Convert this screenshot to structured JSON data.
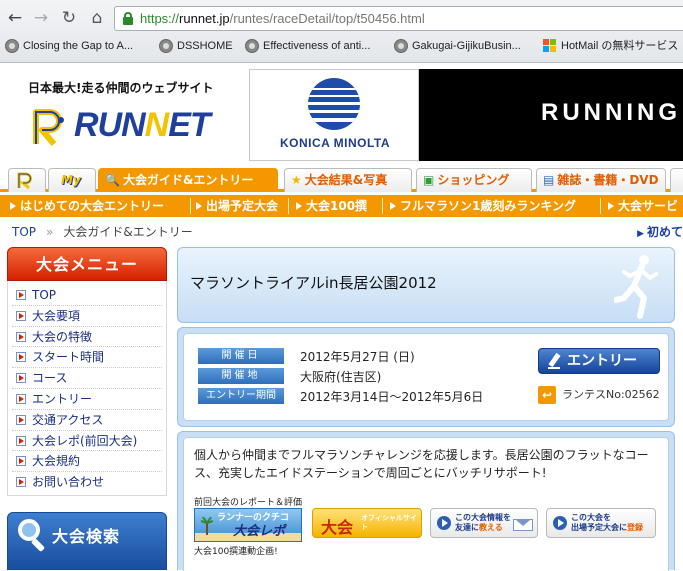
{
  "browser": {
    "url_scheme": "https://",
    "url_host": "runnet.jp",
    "url_path": "/runtes/raceDetail/top/t50456.html",
    "bookmarks": [
      {
        "label": "Closing the Gap to A...",
        "icon": "globe-icon"
      },
      {
        "label": "DSSHOME",
        "icon": "globe-icon"
      },
      {
        "label": "Effectiveness of anti...",
        "icon": "globe-icon"
      },
      {
        "label": "Gakugai-GijikuBusin...",
        "icon": "globe-icon"
      },
      {
        "label": "HotMail の無料サービス",
        "icon": "windows-icon"
      }
    ]
  },
  "site": {
    "tagline": "日本最大!走る仲間のウェブサイト",
    "logo_prefix": "RUN",
    "logo_highlight": "N",
    "logo_suffix": "ET",
    "ad_sponsor": "KONICA MINOLTA",
    "ad_banner": "RUNNING"
  },
  "tabs": [
    {
      "label": "",
      "icon": "runnet-home-icon"
    },
    {
      "label": "My",
      "icon": ""
    },
    {
      "label": "大会ガイド&エントリー",
      "icon": "search-icon",
      "active": true
    },
    {
      "label": "大会結果&写真",
      "icon": "star-icon"
    },
    {
      "label": "ショッピング",
      "icon": "cart-icon"
    },
    {
      "label": "雑誌・書籍・DVD",
      "icon": "book-icon"
    }
  ],
  "subnav": [
    "はじめての大会エントリー",
    "出場予定大会",
    "大会100撰",
    "フルマラソン1歳刻みランキング",
    "大会サービ"
  ],
  "breadcrumb": {
    "top": "TOP",
    "current": "大会ガイド&エントリー",
    "right_link": "初めて"
  },
  "sidebar": {
    "menu_title": "大会メニュー",
    "items": [
      "TOP",
      "大会要項",
      "大会の特徴",
      "スタート時間",
      "コース",
      "エントリー",
      "交通アクセス",
      "大会レポ(前回大会)",
      "大会規約",
      "お問い合わせ"
    ],
    "search_title": "大会検索"
  },
  "race": {
    "title": "マラソントライアルin長居公園2012",
    "date_label": "開催日",
    "date_value": "2012年5月27日 (日)",
    "place_label": "開催地",
    "place_value": "大阪府(住吉区)",
    "period_label": "エントリー期間",
    "period_value": "2012年3月14日～2012年5月6日",
    "entry_button": "エントリー",
    "runtes_no": "ランテスNo:02562",
    "description": "個人から仲間までフルマラソンチャレンジを応援します。長居公園のフラットなコース、充実したエイドステーションで周回ごとにバッチリサポート!",
    "report_label": "前回大会のレポート＆評価",
    "report_banner_top": "ランナーのクチコ",
    "report_banner_main": "大会レポ",
    "report_caption": "大会100撰連動企画!",
    "official_big": "大会",
    "official_small": "オフィシャルサイト",
    "friend_line1": "この大会情報を",
    "friend_line2_pre": "友達に",
    "friend_line2_hl": "教える",
    "plan_line1": "この大会を",
    "plan_line2_pre": "出場予定大会に",
    "plan_line2_hl": "登録"
  },
  "colors": {
    "orange": "#f39800",
    "red_header": "#d52000",
    "blue_link": "#1a3fa3",
    "light_blue": "#c9dff5"
  }
}
